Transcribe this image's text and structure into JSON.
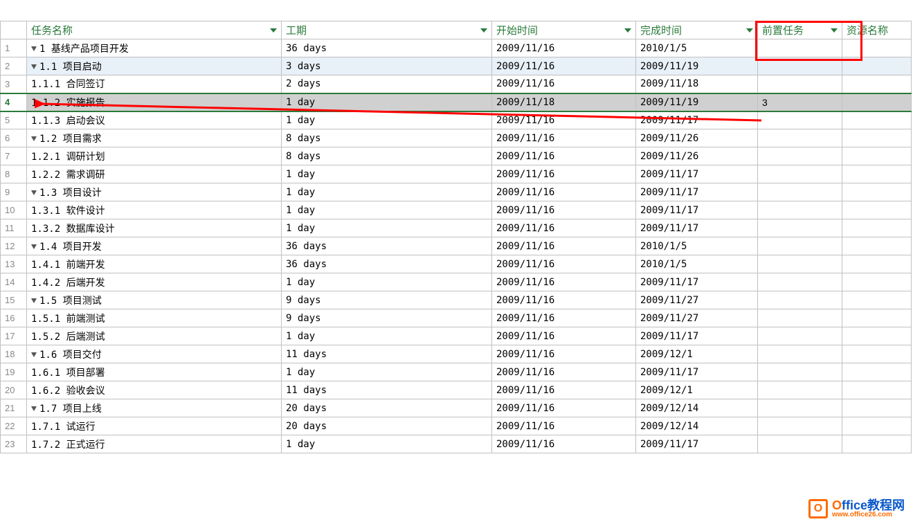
{
  "columns": {
    "name": "任务名称",
    "duration": "工期",
    "start": "开始时间",
    "finish": "完成时间",
    "predecessor": "前置任务",
    "resource": "资源名称"
  },
  "rows": [
    {
      "num": "1",
      "indent": 0,
      "collapse": true,
      "bold": true,
      "name": "1 基线产品项目开发",
      "dur": "36 days",
      "start": "2009/11/16",
      "fin": "2010/1/5",
      "pred": ""
    },
    {
      "num": "2",
      "indent": 1,
      "collapse": true,
      "bold": true,
      "name": "1.1 项目启动",
      "dur": "3 days",
      "start": "2009/11/16",
      "fin": "2009/11/19",
      "pred": "",
      "hl": true
    },
    {
      "num": "3",
      "indent": 2,
      "collapse": false,
      "bold": false,
      "name": "1.1.1 合同签订",
      "dur": "2 days",
      "start": "2009/11/16",
      "fin": "2009/11/18",
      "pred": ""
    },
    {
      "num": "4",
      "indent": 2,
      "collapse": false,
      "bold": false,
      "name": "1.1.2 实施报告",
      "dur": "1 day",
      "start": "2009/11/18",
      "fin": "2009/11/19",
      "pred": "3",
      "sel": true
    },
    {
      "num": "5",
      "indent": 2,
      "collapse": false,
      "bold": false,
      "name": "1.1.3 启动会议",
      "dur": "1 day",
      "start": "2009/11/16",
      "fin": "2009/11/17",
      "pred": ""
    },
    {
      "num": "6",
      "indent": 1,
      "collapse": true,
      "bold": true,
      "name": "1.2 项目需求",
      "dur": "8 days",
      "start": "2009/11/16",
      "fin": "2009/11/26",
      "pred": ""
    },
    {
      "num": "7",
      "indent": 2,
      "collapse": false,
      "bold": false,
      "name": "1.2.1 调研计划",
      "dur": "8 days",
      "start": "2009/11/16",
      "fin": "2009/11/26",
      "pred": ""
    },
    {
      "num": "8",
      "indent": 2,
      "collapse": false,
      "bold": false,
      "name": "1.2.2 需求调研",
      "dur": "1 day",
      "start": "2009/11/16",
      "fin": "2009/11/17",
      "pred": ""
    },
    {
      "num": "9",
      "indent": 1,
      "collapse": true,
      "bold": true,
      "name": "1.3 项目设计",
      "dur": "1 day",
      "start": "2009/11/16",
      "fin": "2009/11/17",
      "pred": ""
    },
    {
      "num": "10",
      "indent": 2,
      "collapse": false,
      "bold": false,
      "name": "1.3.1 软件设计",
      "dur": "1 day",
      "start": "2009/11/16",
      "fin": "2009/11/17",
      "pred": ""
    },
    {
      "num": "11",
      "indent": 2,
      "collapse": false,
      "bold": false,
      "name": "1.3.2 数据库设计",
      "dur": "1 day",
      "start": "2009/11/16",
      "fin": "2009/11/17",
      "pred": ""
    },
    {
      "num": "12",
      "indent": 1,
      "collapse": true,
      "bold": true,
      "name": "1.4 项目开发",
      "dur": "36 days",
      "start": "2009/11/16",
      "fin": "2010/1/5",
      "pred": ""
    },
    {
      "num": "13",
      "indent": 2,
      "collapse": false,
      "bold": false,
      "name": "1.4.1 前端开发",
      "dur": "36 days",
      "start": "2009/11/16",
      "fin": "2010/1/5",
      "pred": ""
    },
    {
      "num": "14",
      "indent": 2,
      "collapse": false,
      "bold": false,
      "name": "1.4.2 后端开发",
      "dur": "1 day",
      "start": "2009/11/16",
      "fin": "2009/11/17",
      "pred": ""
    },
    {
      "num": "15",
      "indent": 1,
      "collapse": true,
      "bold": true,
      "name": "1.5 项目测试",
      "dur": "9 days",
      "start": "2009/11/16",
      "fin": "2009/11/27",
      "pred": ""
    },
    {
      "num": "16",
      "indent": 2,
      "collapse": false,
      "bold": false,
      "name": "1.5.1 前端测试",
      "dur": "9 days",
      "start": "2009/11/16",
      "fin": "2009/11/27",
      "pred": ""
    },
    {
      "num": "17",
      "indent": 2,
      "collapse": false,
      "bold": false,
      "name": "1.5.2 后端测试",
      "dur": "1 day",
      "start": "2009/11/16",
      "fin": "2009/11/17",
      "pred": ""
    },
    {
      "num": "18",
      "indent": 1,
      "collapse": true,
      "bold": true,
      "name": "1.6 项目交付",
      "dur": "11 days",
      "start": "2009/11/16",
      "fin": "2009/12/1",
      "pred": ""
    },
    {
      "num": "19",
      "indent": 2,
      "collapse": false,
      "bold": false,
      "name": "1.6.1 项目部署",
      "dur": "1 day",
      "start": "2009/11/16",
      "fin": "2009/11/17",
      "pred": ""
    },
    {
      "num": "20",
      "indent": 2,
      "collapse": false,
      "bold": false,
      "name": "1.6.2 验收会议",
      "dur": "11 days",
      "start": "2009/11/16",
      "fin": "2009/12/1",
      "pred": ""
    },
    {
      "num": "21",
      "indent": 1,
      "collapse": true,
      "bold": true,
      "name": "1.7 项目上线",
      "dur": "20 days",
      "start": "2009/11/16",
      "fin": "2009/12/14",
      "pred": ""
    },
    {
      "num": "22",
      "indent": 2,
      "collapse": false,
      "bold": false,
      "name": "1.7.1 试运行",
      "dur": "20 days",
      "start": "2009/11/16",
      "fin": "2009/12/14",
      "pred": ""
    },
    {
      "num": "23",
      "indent": 2,
      "collapse": false,
      "bold": false,
      "name": "1.7.2 正式运行",
      "dur": "1 day",
      "start": "2009/11/16",
      "fin": "2009/11/17",
      "pred": ""
    }
  ],
  "watermark": {
    "title": "Office教程网",
    "url": "www.office26.com"
  }
}
